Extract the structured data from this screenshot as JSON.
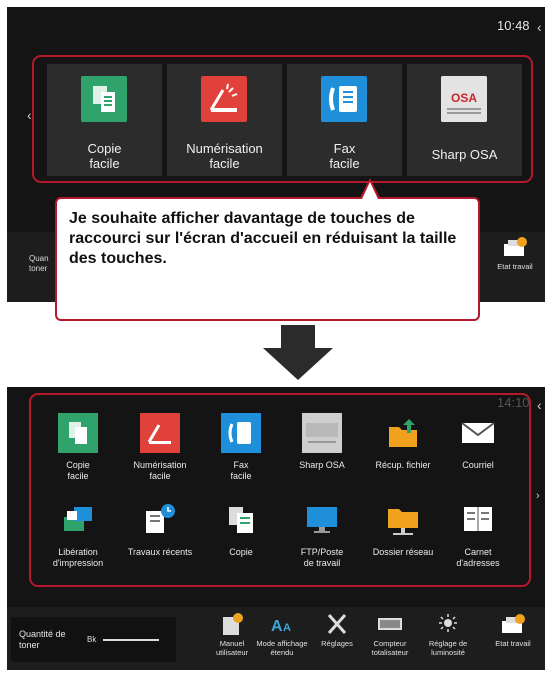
{
  "top_screen": {
    "clock": "10:48",
    "tiles": [
      {
        "label_line1": "Copie",
        "label_line2": "facile"
      },
      {
        "label_line1": "Numérisation",
        "label_line2": "facile"
      },
      {
        "label_line1": "Fax",
        "label_line2": "facile"
      },
      {
        "label_line1": "Sharp OSA",
        "label_line2": ""
      }
    ],
    "bottom_left": {
      "line1": "Quan",
      "line2": "toner"
    },
    "bottom_right": "Etat travail"
  },
  "callout": {
    "text": "Je souhaite afficher davantage de touches de raccourci sur l'écran d'accueil en réduisant la taille des touches."
  },
  "bottom_screen": {
    "clock": "14:10",
    "tiles": [
      {
        "line1": "Copie",
        "line2": "facile",
        "icon": "copy-icon"
      },
      {
        "line1": "Numérisation",
        "line2": "facile",
        "icon": "scan-icon"
      },
      {
        "line1": "Fax",
        "line2": "facile",
        "icon": "fax-icon"
      },
      {
        "line1": "Sharp OSA",
        "line2": "",
        "icon": "sharp-osa-icon"
      },
      {
        "line1": "Récup. fichier",
        "line2": "",
        "icon": "file-retrieve-icon"
      },
      {
        "line1": "Courriel",
        "line2": "",
        "icon": "email-icon"
      },
      {
        "line1": "Libération",
        "line2": "d'impression",
        "icon": "print-release-icon"
      },
      {
        "line1": "Travaux récents",
        "line2": "",
        "icon": "recent-jobs-icon"
      },
      {
        "line1": "Copie",
        "line2": "",
        "icon": "copy-icon"
      },
      {
        "line1": "FTP/Poste",
        "line2": "de travail",
        "icon": "ftp-desktop-icon"
      },
      {
        "line1": "Dossier réseau",
        "line2": "",
        "icon": "network-folder-icon"
      },
      {
        "line1": "Carnet",
        "line2": "d'adresses",
        "icon": "address-book-icon"
      }
    ],
    "toner": {
      "line1": "Quantité de",
      "line2": "toner",
      "color": "Bk"
    },
    "bar_items": [
      {
        "line1": "Manuel",
        "line2": "utilisateur"
      },
      {
        "line1": "Mode affichage",
        "line2": "étendu"
      },
      {
        "line1": "Réglages",
        "line2": ""
      },
      {
        "line1": "Compteur",
        "line2": "totalisateur"
      },
      {
        "line1": "Réglage de",
        "line2": "luminosité"
      },
      {
        "line1": "Etat travail",
        "line2": ""
      }
    ]
  },
  "colors": {
    "highlight_frame": "#b5182a",
    "screen_bg": "#141414",
    "copy_green": "#2fa36b",
    "scan_red": "#e0413a",
    "fax_blue": "#1e8fd8",
    "folder_orange": "#f0a21e"
  }
}
